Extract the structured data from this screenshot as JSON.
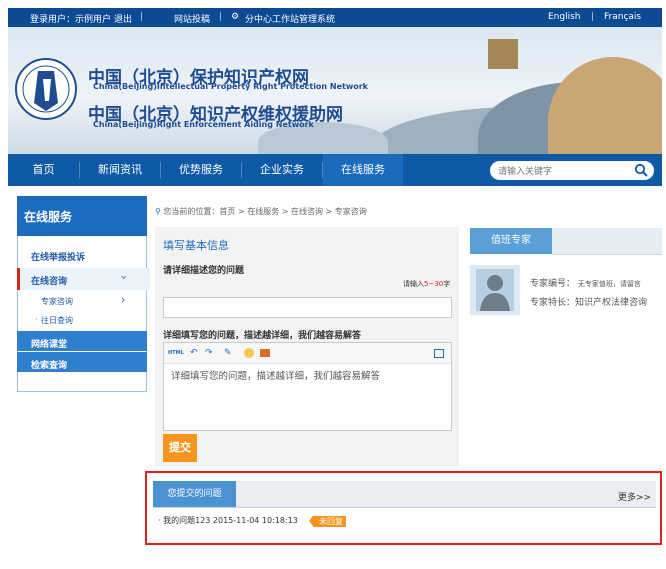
{
  "topbar": {
    "user_prefix": "登录用户：示例用户",
    "logout": "退出",
    "submit_article": "网站投稿",
    "admin_system": "分中心工作站管理系统",
    "english": "English",
    "francais": "Français"
  },
  "banner": {
    "title_cn_1": "中国（北京）保护知识产权网",
    "title_en_1": "China(Beijing)Intellectual Property Right Protection Network",
    "title_cn_2": "中国（北京）知识产权维权援助网",
    "title_en_2": "China(Beijing)Right Enforcement Aiding Network"
  },
  "nav": {
    "items": [
      "首页",
      "新闻资讯",
      "优势服务",
      "企业实务",
      "在线服务"
    ],
    "search_placeholder": "请输入关键字"
  },
  "sidebar": {
    "title": "在线服务",
    "items": [
      "在线举报投诉",
      "在线咨询",
      "专家咨询",
      "往日查询",
      "网络课堂",
      "检索查询"
    ],
    "arrow": "›"
  },
  "breadcrumb": {
    "prefix": "您当前的位置：",
    "items": [
      "首页",
      "在线服务",
      "在线咨询",
      "专家咨询"
    ],
    "sep": ">"
  },
  "form": {
    "heading": "填写基本信息",
    "q_label": "请详细描述您的问题",
    "hint_pre": "请输入",
    "hint_range": "5~30",
    "hint_post": "字",
    "detail_label": "详细填写您的问题，描述越详细，我们越容易解答",
    "editor_text": "详细填写您的问题，描述越详细，我们越容易解答",
    "submit": "提交"
  },
  "expert": {
    "tab": "值班专家",
    "id_label": "专家编号：",
    "id_value": "无专家值班，请留言",
    "spec_label": "专家特长：",
    "spec_value": "知识产权法律咨询"
  },
  "questions": {
    "tab": "您提交的问题",
    "more": "更多>>",
    "items": [
      {
        "text": "我的问题123 2015-11-04 10:18:13",
        "status": "未回复"
      }
    ]
  },
  "colors": {
    "primary": "#0e5aa7",
    "accent": "#f7941d",
    "highlight": "#e0201d"
  }
}
